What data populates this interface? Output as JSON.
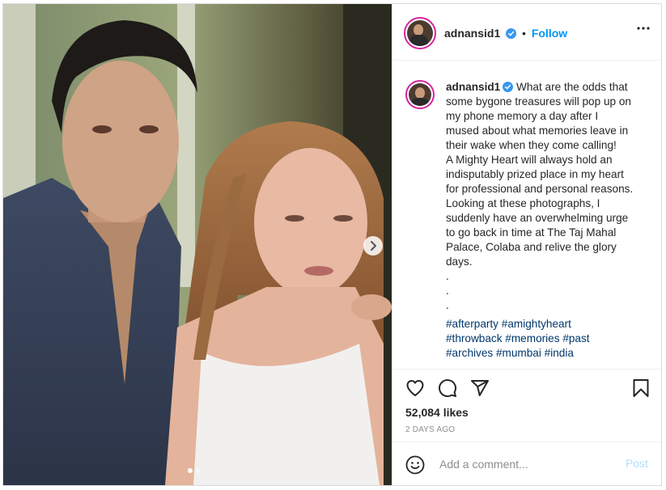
{
  "post": {
    "username": "adnansid1",
    "verified": true,
    "follow_separator": "•",
    "follow_label": "Follow",
    "more_icon": "more-options-icon",
    "caption": {
      "username": "adnansid1",
      "lines": [
        "What are the odds that",
        "some bygone treasures will pop up on",
        "my phone memory a day after I",
        "mused about what memories leave in",
        "their wake when they come calling!",
        "A Mighty Heart will always hold an",
        "indisputably prized place in my heart",
        "for professional and personal reasons.",
        "Looking at these photographs, I",
        "suddenly have an overwhelming urge",
        "to go back in time at The Taj Mahal",
        "Palace, Colaba and relive the glory",
        "days.",
        ".",
        ".",
        "."
      ]
    },
    "hashtags": [
      [
        "#afterparty",
        "#amightyheart"
      ],
      [
        "#throwback",
        "#memories",
        "#past"
      ],
      [
        "#archives",
        "#mumbai",
        "#india"
      ]
    ],
    "actions": {
      "like_icon": "heart-icon",
      "comment_icon": "comment-icon",
      "share_icon": "share-icon",
      "save_icon": "bookmark-icon"
    },
    "likes": "52,084 likes",
    "time_ago": "2 DAYS AGO",
    "comment": {
      "placeholder": "Add a comment...",
      "post_label": "Post",
      "emoji_icon": "emoji-icon"
    },
    "carousel": {
      "slides": 2,
      "current": 1
    }
  },
  "colors": {
    "link": "#0095f6",
    "hashtag": "#00376b",
    "post_disabled": "#b2dffc",
    "verified": "#3897f0"
  }
}
